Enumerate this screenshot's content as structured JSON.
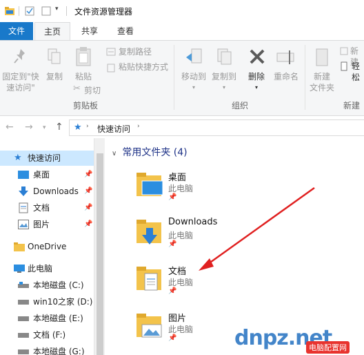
{
  "window": {
    "title": "文件资源管理器"
  },
  "tabs": {
    "file": "文件",
    "home": "主页",
    "share": "共享",
    "view": "查看"
  },
  "ribbon": {
    "pin_line1": "固定到\"快",
    "pin_line2": "速访问\"",
    "copy": "复制",
    "paste": "粘贴",
    "copy_path": "复制路径",
    "paste_shortcut": "粘贴快捷方式",
    "cut": "剪切",
    "clipboard_group": "剪贴板",
    "move_to": "移动到",
    "copy_to": "复制到",
    "delete": "删除",
    "rename": "重命名",
    "organize_group": "组织",
    "new_folder_line1": "新建",
    "new_folder_line2": "文件夹",
    "new_item": "新建",
    "easy_access": "轻松",
    "new_group": "新建"
  },
  "address": {
    "location": "快速访问"
  },
  "nav": {
    "quick_access": "快速访问",
    "items": [
      "桌面",
      "Downloads",
      "文档",
      "图片"
    ],
    "onedrive": "OneDrive",
    "this_pc": "此电脑",
    "drives": [
      "本地磁盘 (C:)",
      "win10之家 (D:)",
      "本地磁盘 (E:)",
      "文档 (F:)",
      "本地磁盘 (G:)"
    ]
  },
  "content": {
    "section_title": "常用文件夹 (4)",
    "folders": [
      {
        "name": "桌面",
        "location": "此电脑"
      },
      {
        "name": "Downloads",
        "location": "此电脑"
      },
      {
        "name": "文档",
        "location": "此电脑"
      },
      {
        "name": "图片",
        "location": "此电脑"
      }
    ]
  },
  "watermark": {
    "logo": "dnpz.net",
    "badge": "电脑配置网"
  },
  "colors": {
    "file_tab": "#1979ca",
    "selection": "#cce8ff",
    "folder": "#f3c34b",
    "arrow": "#e02020",
    "section_title": "#1e3287"
  }
}
